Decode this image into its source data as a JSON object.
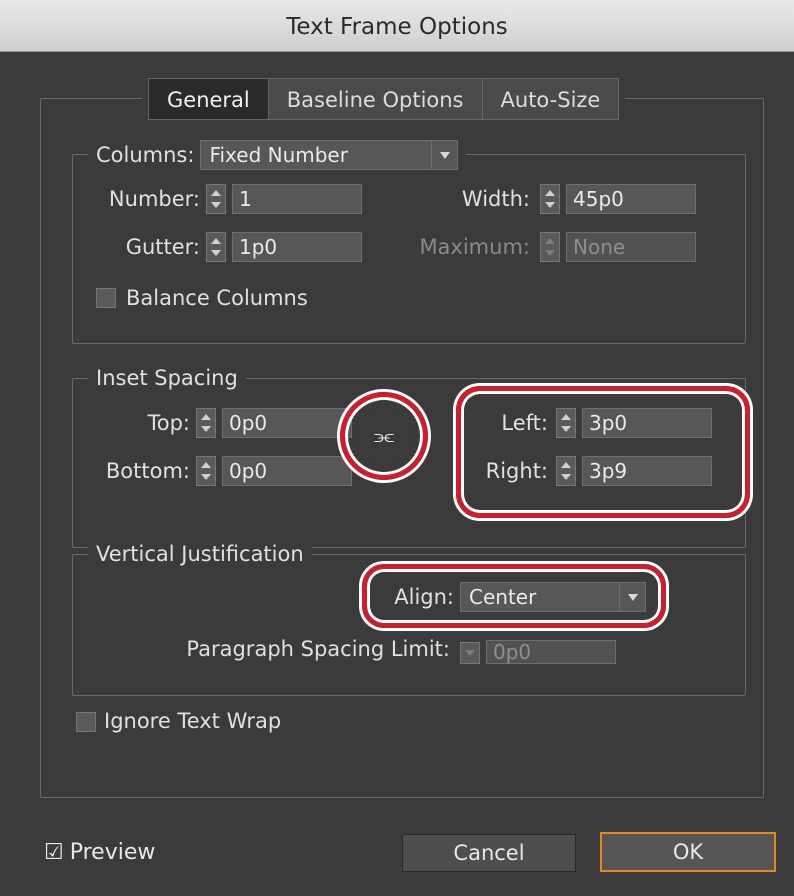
{
  "window": {
    "title": "Text Frame Options"
  },
  "tabs": [
    {
      "label": "General",
      "active": true
    },
    {
      "label": "Baseline Options",
      "active": false
    },
    {
      "label": "Auto-Size",
      "active": false
    }
  ],
  "columns": {
    "legend_label": "Columns:",
    "type_value": "Fixed Number",
    "number_label": "Number:",
    "number_value": "1",
    "width_label": "Width:",
    "width_value": "45p0",
    "gutter_label": "Gutter:",
    "gutter_value": "1p0",
    "maximum_label": "Maximum:",
    "maximum_value": "None",
    "balance_label": "Balance Columns",
    "balance_checked": false
  },
  "inset_spacing": {
    "legend": "Inset Spacing",
    "top_label": "Top:",
    "top_value": "0p0",
    "bottom_label": "Bottom:",
    "bottom_value": "0p0",
    "left_label": "Left:",
    "left_value": "3p0",
    "right_label": "Right:",
    "right_value": "3p9",
    "link_icon": "chain-link-broken"
  },
  "vertical_justification": {
    "legend": "Vertical Justification",
    "align_label": "Align:",
    "align_value": "Center",
    "spacing_limit_label": "Paragraph Spacing Limit:",
    "spacing_limit_value": "0p0"
  },
  "ignore_text_wrap": {
    "label": "Ignore Text Wrap",
    "checked": false
  },
  "footer": {
    "preview_label": "Preview",
    "preview_checked": true,
    "cancel_label": "Cancel",
    "ok_label": "OK"
  },
  "colors": {
    "highlight": "#c8202d",
    "ok_border": "#e08a1e",
    "dialog_bg": "#3b3b3b"
  }
}
